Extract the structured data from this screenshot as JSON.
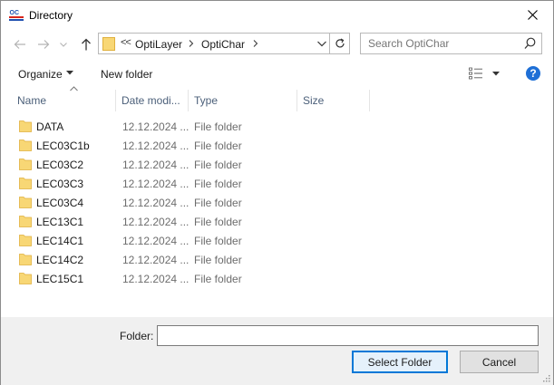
{
  "window": {
    "title": "Directory"
  },
  "nav": {
    "breadcrumb_overflow": "<<",
    "breadcrumbs": [
      "OptiLayer",
      "OptiChar"
    ]
  },
  "search": {
    "placeholder": "Search OptiChar"
  },
  "toolbar": {
    "organize_label": "Organize",
    "new_folder_label": "New folder"
  },
  "columns": [
    "Name",
    "Date modi...",
    "Type",
    "Size"
  ],
  "files": [
    {
      "name": "DATA",
      "date": "12.12.2024 ...",
      "type": "File folder"
    },
    {
      "name": "LEC03C1b",
      "date": "12.12.2024 ...",
      "type": "File folder"
    },
    {
      "name": "LEC03C2",
      "date": "12.12.2024 ...",
      "type": "File folder"
    },
    {
      "name": "LEC03C3",
      "date": "12.12.2024 ...",
      "type": "File folder"
    },
    {
      "name": "LEC03C4",
      "date": "12.12.2024 ...",
      "type": "File folder"
    },
    {
      "name": "LEC13C1",
      "date": "12.12.2024 ...",
      "type": "File folder"
    },
    {
      "name": "LEC14C1",
      "date": "12.12.2024 ...",
      "type": "File folder"
    },
    {
      "name": "LEC14C2",
      "date": "12.12.2024 ...",
      "type": "File folder"
    },
    {
      "name": "LEC15C1",
      "date": "12.12.2024 ...",
      "type": "File folder"
    }
  ],
  "footer": {
    "folder_label": "Folder:",
    "folder_value": "",
    "select_label": "Select Folder",
    "cancel_label": "Cancel"
  },
  "colors": {
    "folder": "#f8d775",
    "folder_dark": "#e8b84a",
    "accent": "#0078d7",
    "help": "#1e6fd6"
  }
}
